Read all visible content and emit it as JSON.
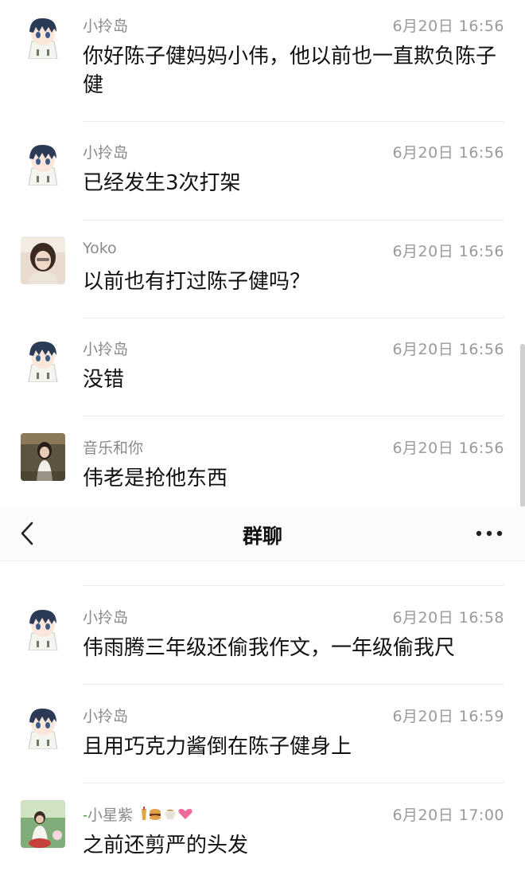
{
  "nav": {
    "title": "群聊"
  },
  "icons": {
    "back": "chevron-left-icon",
    "more": "more-dots-icon"
  },
  "messages": [
    {
      "sender": "小拎岛",
      "time": "6月20日  16:56",
      "text": "你好陈子健妈妈小伟，他以前也一直欺负陈子健",
      "avatar": "anime-boy-avatar"
    },
    {
      "sender": "小拎岛",
      "time": "6月20日  16:56",
      "text": "已经发生3次打架",
      "avatar": "anime-boy-avatar"
    },
    {
      "sender": "Yoko",
      "time": "6月20日  16:56",
      "text": "以前也有打过陈子健吗？",
      "avatar": "photo-avatar"
    },
    {
      "sender": "小拎岛",
      "time": "6月20日  16:56",
      "text": "没错",
      "avatar": "anime-boy-avatar"
    },
    {
      "sender": "音乐和你",
      "time": "6月20日  16:56",
      "text": "伟老是抢他东西",
      "avatar": "photo-avatar"
    },
    {
      "sender": "小拎岛",
      "time": "6月20日  16:58",
      "text": "伟雨腾三年级还偷我作文，一年级偷我尺",
      "avatar": "anime-boy-avatar"
    },
    {
      "sender": "小拎岛",
      "time": "6月20日  16:59",
      "text": "且用巧克力酱倒在陈子健身上",
      "avatar": "anime-boy-avatar"
    },
    {
      "sender": "小星紫",
      "time": "6月20日  17:00",
      "text": "之前还剪严的头发",
      "avatar": "photo-avatar"
    }
  ]
}
